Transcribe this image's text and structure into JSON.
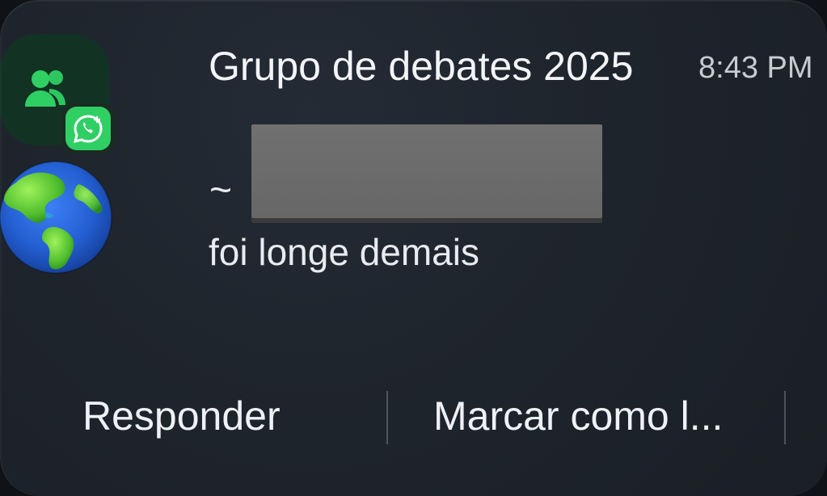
{
  "notification": {
    "app_name": "WhatsApp",
    "icon": "group-icon",
    "badge_icon": "whatsapp-icon",
    "avatar_icon": "globe-icon",
    "title": "Grupo de debates 2025",
    "time": "8:43 PM",
    "sender_prefix": "~",
    "message": "foi longe demais",
    "colors": {
      "background": "#1f252d",
      "icon_bg": "#123323",
      "accent": "#2fcf64"
    }
  },
  "actions": {
    "reply_label": "Responder",
    "mark_read_label": "Marcar como l..."
  }
}
